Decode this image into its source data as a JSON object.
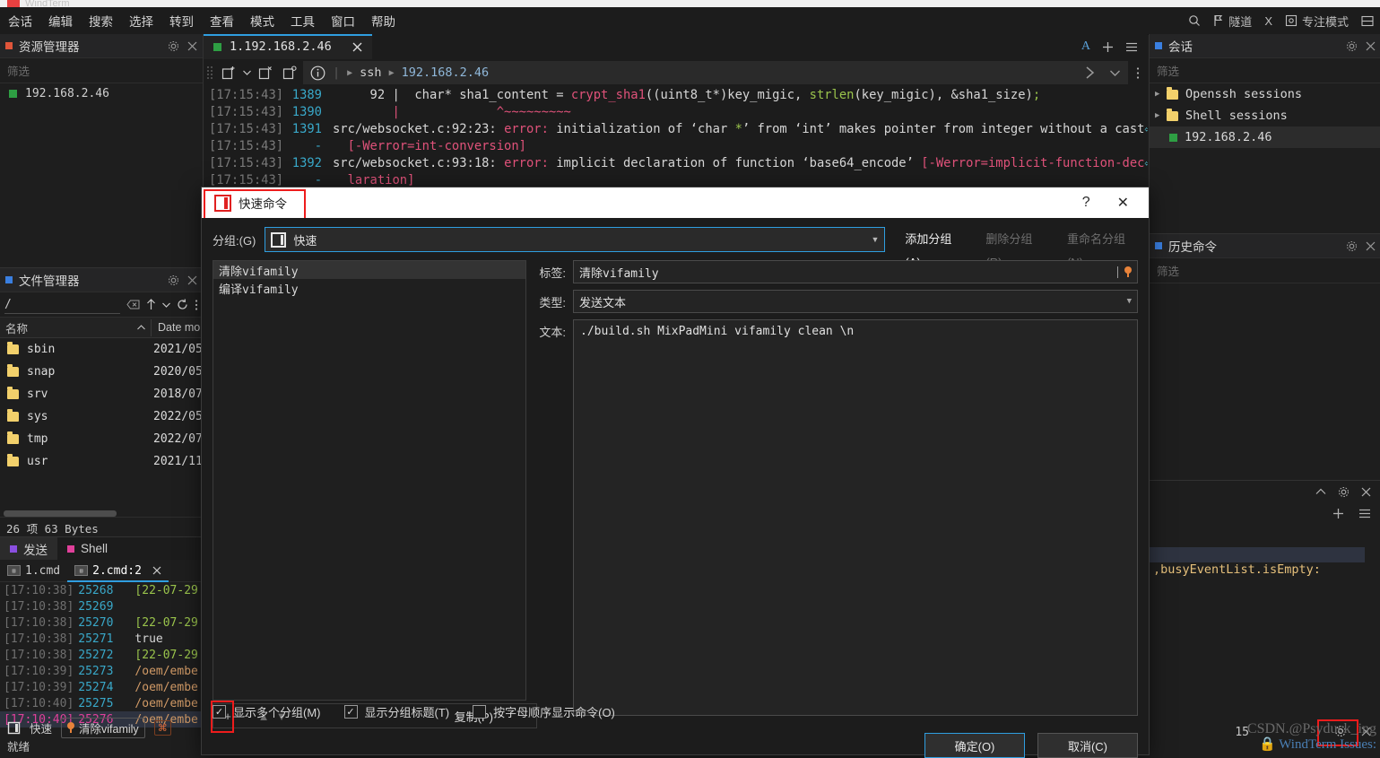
{
  "titlebar": {
    "text": "WindTerm"
  },
  "menubar": {
    "items": [
      "会话",
      "编辑",
      "搜索",
      "选择",
      "转到",
      "查看",
      "模式",
      "工具",
      "窗口",
      "帮助"
    ],
    "right": [
      {
        "icon": "search-icon",
        "label": ""
      },
      {
        "icon": "flag-icon",
        "label": "隧道"
      },
      {
        "icon": "x-icon",
        "label": "X"
      },
      {
        "icon": "focus-icon",
        "label": "专注模式"
      },
      {
        "icon": "layout-icon",
        "label": ""
      }
    ]
  },
  "explorer": {
    "title": "资源管理器",
    "filter_placeholder": "筛选",
    "items": [
      {
        "label": "192.168.2.46"
      }
    ]
  },
  "filemanager": {
    "title": "文件管理器",
    "path": "/",
    "columns": [
      "名称",
      "Date mo"
    ],
    "rows": [
      {
        "name": "sbin",
        "date": "2021/05"
      },
      {
        "name": "snap",
        "date": "2020/05"
      },
      {
        "name": "srv",
        "date": "2018/07"
      },
      {
        "name": "sys",
        "date": "2022/05"
      },
      {
        "name": "tmp",
        "date": "2022/07"
      },
      {
        "name": "usr",
        "date": "2021/11"
      }
    ],
    "status": "26 项 63 Bytes"
  },
  "leftlog": {
    "tabs": [
      {
        "label": "发送",
        "color": "#8a4fe0"
      },
      {
        "label": "Shell",
        "color": "#e0409a"
      }
    ],
    "subtabs": [
      {
        "label": "1.cmd"
      },
      {
        "label": "2.cmd:2"
      }
    ],
    "lines": [
      {
        "ts": "[17:10:38]",
        "no": "25268",
        "msg": "[22-07-29"
      },
      {
        "ts": "[17:10:38]",
        "no": "25269",
        "msg": ""
      },
      {
        "ts": "[17:10:38]",
        "no": "25270",
        "msg": "[22-07-29"
      },
      {
        "ts": "[17:10:38]",
        "no": "25271",
        "msg": "true"
      },
      {
        "ts": "[17:10:38]",
        "no": "25272",
        "msg": "[22-07-29"
      },
      {
        "ts": "[17:10:39]",
        "no": "25273",
        "msg": "/oem/embe"
      },
      {
        "ts": "[17:10:39]",
        "no": "25274",
        "msg": "/oem/embe"
      },
      {
        "ts": "[17:10:40]",
        "no": "25275",
        "msg": "/oem/embe"
      },
      {
        "ts": "[17:10:40]",
        "no": "25276",
        "msg": "/oem/embe"
      }
    ]
  },
  "terminal": {
    "tab_label": "1.192.168.2.46",
    "crumb_proto": "ssh",
    "crumb_host": "192.168.2.46",
    "lines": [
      {
        "ts": "[17:15:43]",
        "no": "1389",
        "segs": [
          {
            "t": "     92 |  char* sha1_content = ",
            "c": "w"
          },
          {
            "t": "crypt_sha1",
            "c": "red"
          },
          {
            "t": "((uint8_t*)key_migic, ",
            "c": "w"
          },
          {
            "t": "strlen",
            "c": "grn"
          },
          {
            "t": "(key_migic), &sha1_size)",
            "c": "w"
          },
          {
            "t": ";",
            "c": "grn"
          }
        ]
      },
      {
        "ts": "[17:15:43]",
        "no": "1390",
        "segs": [
          {
            "t": "        |             ^~~~~~~~~~",
            "c": "red"
          }
        ]
      },
      {
        "ts": "[17:15:43]",
        "no": "1391",
        "segs": [
          {
            "t": "src/websocket.c:92:23: ",
            "c": "w"
          },
          {
            "t": "error:",
            "c": "red"
          },
          {
            "t": " initialization of ‘char ",
            "c": "w"
          },
          {
            "t": "*",
            "c": "grn"
          },
          {
            "t": "’ from ‘int’ makes pointer from integer without a cast",
            "c": "w"
          },
          {
            "t": "⏎",
            "c": "cyan"
          }
        ]
      },
      {
        "ts": "[17:15:43]",
        "no": "-",
        "segs": [
          {
            "t": "  [-Werror=int-conversion]",
            "c": "pnk"
          }
        ]
      },
      {
        "ts": "[17:15:43]",
        "no": "1392",
        "segs": [
          {
            "t": "src/websocket.c:93:18: ",
            "c": "w"
          },
          {
            "t": "error:",
            "c": "red"
          },
          {
            "t": " implicit declaration of function ‘base64_encode’ ",
            "c": "w"
          },
          {
            "t": "[-Werror=implicit-function-dec",
            "c": "pnk"
          },
          {
            "t": "⏎",
            "c": "cyan"
          }
        ]
      },
      {
        "ts": "[17:15:43]",
        "no": "-",
        "segs": [
          {
            "t": "  laration]",
            "c": "pnk"
          }
        ]
      }
    ]
  },
  "sessions": {
    "title": "会话",
    "filter_placeholder": "筛选",
    "items": [
      {
        "label": "Openssh sessions",
        "type": "folder",
        "expandable": true
      },
      {
        "label": "Shell sessions",
        "type": "folder",
        "expandable": true
      },
      {
        "label": "192.168.2.46",
        "type": "host",
        "expandable": false
      }
    ]
  },
  "history": {
    "title": "历史命令",
    "filter_placeholder": "筛选"
  },
  "rightlog": {
    "line": ",busyEventList.isEmpty:"
  },
  "statusbar": {
    "quick_label": "快速",
    "chip_label": "清除vifamily",
    "kbd": "⌘",
    "state": "就绪",
    "count": "15"
  },
  "dialog": {
    "title": "快速命令",
    "help": "?",
    "close": "✕",
    "group_label": "分组:(G)",
    "group_value": "快速",
    "buttons": {
      "add_group": "添加分组(A)",
      "delete_group": "删除分组(R)",
      "rename_group": "重命名分组(N)"
    },
    "commands": [
      {
        "label": "清除vifamily",
        "selected": true
      },
      {
        "label": "编译vifamily",
        "selected": false
      }
    ],
    "list_buttons": {
      "add": "+",
      "remove": "−",
      "up": "▲",
      "down": "▼",
      "copy": "复制(P)"
    },
    "form": {
      "label_label": "标签:",
      "label_value": "清除vifamily",
      "type_label": "类型:",
      "type_value": "发送文本",
      "text_label": "文本:",
      "text_value": "./build.sh MixPadMini vifamily clean \\n"
    },
    "checkboxes": [
      {
        "label": "显示多个分组(M)",
        "checked": true
      },
      {
        "label": "显示分组标题(T)",
        "checked": true
      },
      {
        "label": "按字母顺序显示命令(O)",
        "checked": false
      }
    ],
    "ok": "确定(O)",
    "cancel": "取消(C)"
  },
  "watermark": {
    "l1": "CSDN.@Psyduck_ing",
    "l2": "WindTerm Issues:",
    "l3": "锁屏"
  }
}
